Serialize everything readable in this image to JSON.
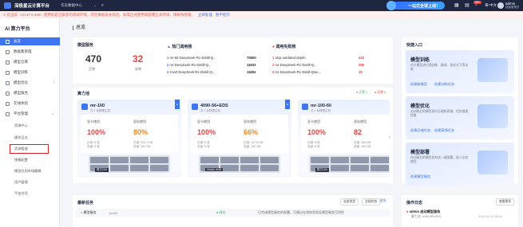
{
  "topbar": {
    "title": "深极星云计算平台",
    "region": "华东数据中心",
    "cta": "一站式全球上线！",
    "badge": "99+",
    "lang": "中文",
    "user": "admin",
    "role": "超级管理员"
  },
  "notice": {
    "text": "© 您当前（10.37.0.168）使用的是已安装的测试环境，存在数据丢失风险。如需正式使用请部署正式环境，请联系客服。",
    "link1": "立即处理",
    "link2": "暂不提示"
  },
  "sidebar": {
    "title": "AI 算力平台",
    "items": [
      {
        "label": "总览",
        "active": true
      },
      {
        "label": "数据集管理"
      },
      {
        "label": "模型仓库"
      },
      {
        "label": "模型训练"
      },
      {
        "label": "模型优化",
        "arrow": "›"
      },
      {
        "label": "模型服务"
      },
      {
        "label": "在线体验"
      },
      {
        "label": "平台管理",
        "arrow": "⌄"
      }
    ],
    "sub": [
      "资源中心",
      "操作日志",
      "资源管理",
      "镜像配置",
      "模型应用市场编辑",
      "用户管理",
      "平台对话"
    ]
  },
  "main": {
    "page_title": "总览"
  },
  "service": {
    "title": "模型服务",
    "normal_count": "470",
    "normal_label": "正常",
    "abnormal_count": "32",
    "abnormal_label": "异常"
  },
  "hot": {
    "title": "热门调用榜",
    "rows": [
      {
        "name": "mr-60-DeepSeek-R1-Distill-Q...",
        "value": "70500"
      },
      {
        "name": "mr-DeepSeek-R1-Distill-Q...",
        "value": "11933"
      },
      {
        "name": "zcw2-DeepSeek-R1-Distill-Q...",
        "value": "11651"
      }
    ]
  },
  "errors": {
    "title": "调用失败榜",
    "rows": [
      {
        "name": "alcp-outdated-depkh",
        "value": "418"
      },
      {
        "name": "mr-DeepSeek-R1-Distill-Q...",
        "value": "358"
      },
      {
        "name": "mr-DeepSeek-R1-Distill-Qwe...",
        "value": "18"
      }
    ]
  },
  "compute": {
    "title": "算力池",
    "legend": [
      "● 正常 1",
      "● 异常 0"
    ],
    "gpus": [
      {
        "name": "mr-100",
        "sub": "共 1 台物理主机",
        "tag": "A",
        "mem_label": "显卡使用",
        "store_label": "显存使用",
        "mem": "100%",
        "store": "80%",
        "metrics": "已用: 8 张\n总量: 8 张",
        "metrics2": "已用: 320.7 GB\n总量: 320 GB",
        "chip": "算力100"
      },
      {
        "name": "4090-56+EDS",
        "sub": "共 1 台物理主机",
        "tag": "B",
        "mem_label": "显卡使用",
        "store_label": "显存使用",
        "mem": "100%",
        "store": "66%",
        "metrics": "已用: 8 张\n总量: 8 张",
        "metrics2": "已用: 127.3 GB\n总量: 192 GB",
        "chip": "Nvidia 4090"
      },
      {
        "name": "mr-100-60",
        "sub": "共 1 台物理主机",
        "tag": "C",
        "mem_label": "显卡使用",
        "store_label": "显存使用",
        "mem": "100%",
        "store": "82",
        "metrics": "已用: 8 张\n总量: 8 张",
        "metrics2": "已用: 320 GB\n总量: 320 GB",
        "chip": "算力100"
      }
    ]
  },
  "tasks": {
    "title": "最新任务",
    "filter1": "全部类型",
    "filter2": "全部状态",
    "more": "更多",
    "row_type": "○ 模型服务",
    "row_name": "bm63",
    "row_status": "● 成功",
    "row_desc": "已完成模型服务的部署，可通过在线体验验证模型服务可用性"
  },
  "quick": {
    "title": "快捷入口",
    "cards": [
      {
        "title": "模型训练",
        "desc": "对大模型进行预训练、精调、强化学习等训练",
        "a1": "创建新模型",
        "a2": "创建训练任务"
      },
      {
        "title": "模型优化",
        "desc": "对训练后的模型进行压缩和蒸馏，优化推理性能",
        "a1": "创建压缩任务",
        "a2": "创建蒸馏任务"
      },
      {
        "title": "模型部署",
        "desc": "对训练后的模型发布成一键部署，接入业务使用",
        "a1": "创建模型服务"
      }
    ]
  },
  "oplog": {
    "title": "操作日志",
    "more": "查看更多",
    "user": "admin 启动模型服务",
    "detail": "算力池: 4090-56+EDS",
    "time": "2025-03-11 08:53"
  }
}
